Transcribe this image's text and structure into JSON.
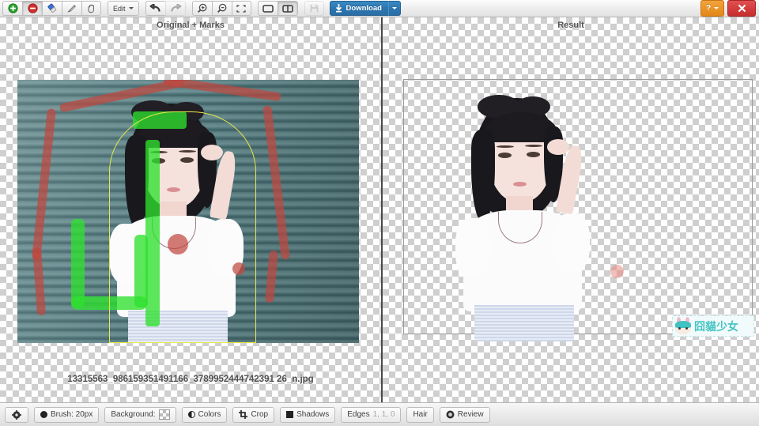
{
  "toolbar": {
    "tools": [
      {
        "name": "add-foreground-tool",
        "icon": "plus-circle-green-icon",
        "pressed": false
      },
      {
        "name": "remove-background-tool",
        "icon": "minus-circle-red-icon",
        "pressed": true
      },
      {
        "name": "eraser-tool",
        "icon": "eraser-icon",
        "pressed": false
      },
      {
        "name": "pen-tool",
        "icon": "pen-icon",
        "pressed": false
      },
      {
        "name": "pan-tool",
        "icon": "hand-icon",
        "pressed": false
      }
    ],
    "edit_label": "Edit",
    "undo_label": "undo-arrow-icon",
    "redo_label": "redo-arrow-icon",
    "zoom_in_label": "zoom-in-icon",
    "zoom_out_label": "zoom-out-icon",
    "fit_label": "fit-screen-icon",
    "single_view_label": "single-pane-icon",
    "split_view_label": "split-pane-icon",
    "save_label": "save-disk-icon",
    "download_label": "Download",
    "help_label": "?",
    "close_label": "✕"
  },
  "panels": {
    "left_title": "Original + Marks",
    "right_title": "Result",
    "filename": "13315563_986159351491166_3789952444742391 26_n.jpg"
  },
  "watermark": {
    "text": "囧貓少女"
  },
  "bottombar": {
    "settings_label": "",
    "brush_label": "Brush: 20px",
    "background_label": "Background:",
    "colors_label": "Colors",
    "crop_label": "Crop",
    "shadows_label": "Shadows",
    "edges_label": "Edges",
    "edges_values": "1, 1, 0",
    "hair_label": "Hair",
    "review_label": "Review"
  },
  "colors": {
    "accent_blue": "#2d76b0",
    "help_orange": "#eb9326",
    "close_red": "#d33c3c",
    "mark_red": "#c1463f",
    "mark_green": "#2ee02e",
    "outline_yellow": "#e8e84a",
    "watermark_teal": "#45c3c3"
  }
}
